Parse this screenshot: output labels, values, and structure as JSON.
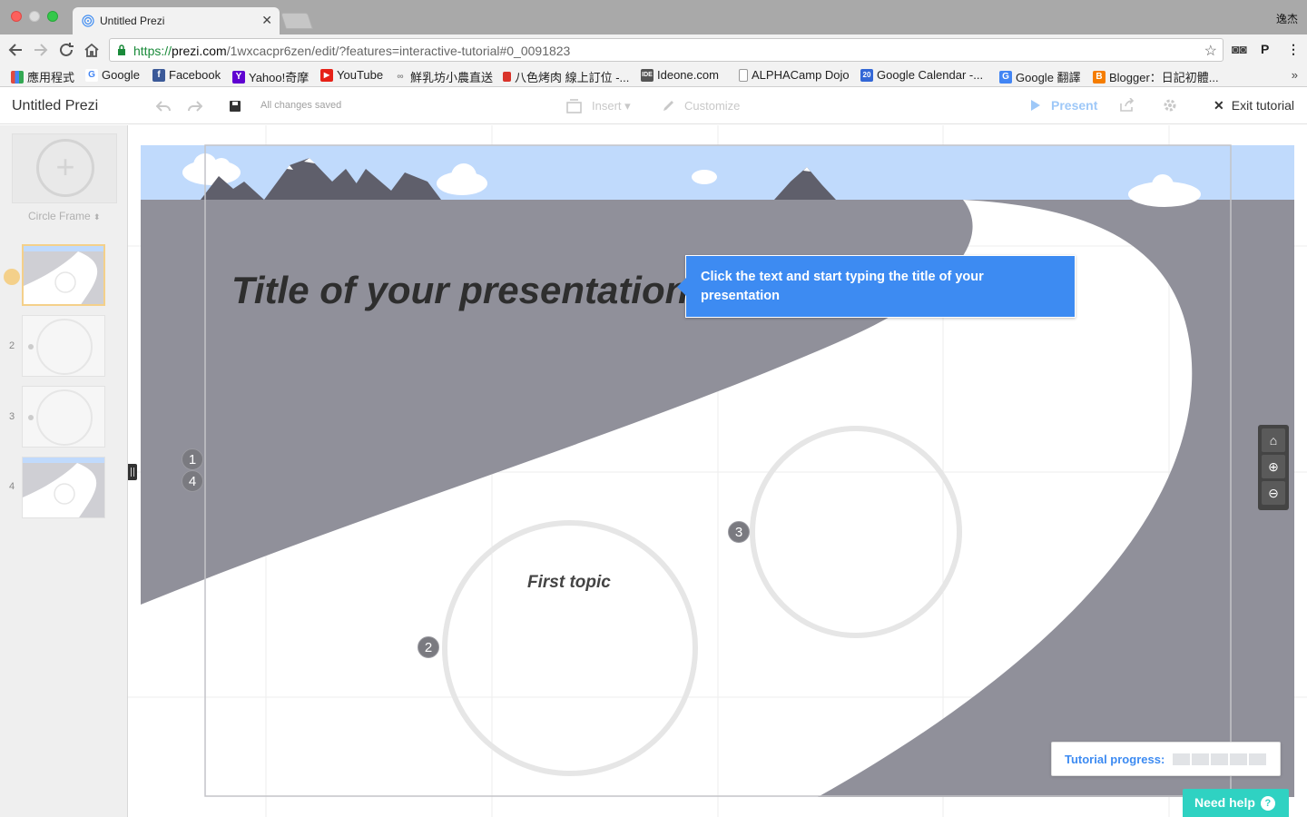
{
  "browser": {
    "tab_title": "Untitled Prezi",
    "profile_name": "逸杰",
    "url_scheme": "https://",
    "url_host": "prezi.com",
    "url_path": "/1wxcacpr6zen/edit/?features=interactive-tutorial#0_0091823"
  },
  "bookmarks": [
    {
      "label": "應用程式",
      "icon": "apps-grid-icon",
      "color": "#e04a3f"
    },
    {
      "label": "Google",
      "icon": "google-icon",
      "color": "#4285f4"
    },
    {
      "label": "Facebook",
      "icon": "facebook-icon",
      "color": "#3b5998"
    },
    {
      "label": "Yahoo!奇摩",
      "icon": "yahoo-icon",
      "color": "#5f01d1"
    },
    {
      "label": "YouTube",
      "icon": "youtube-icon",
      "color": "#e62117"
    },
    {
      "label": "鮮乳坊小農直送",
      "icon": "link-icon",
      "color": "#888888"
    },
    {
      "label": "八色烤肉 線上訂位 -...",
      "icon": "restaurant-icon",
      "color": "#d9342b"
    },
    {
      "label": "Ideone.com",
      "icon": "ideone-icon",
      "color": "#555555"
    },
    {
      "label": "ALPHACamp Dojo",
      "icon": "page-icon",
      "color": "#999999"
    },
    {
      "label": "Google Calendar -...",
      "icon": "calendar-icon",
      "color": "#3367d6"
    },
    {
      "label": "Google 翻譯",
      "icon": "translate-icon",
      "color": "#4285f4"
    },
    {
      "label": "Blogger：日記初體...",
      "icon": "blogger-icon",
      "color": "#f57d00"
    }
  ],
  "toolbar": {
    "title": "Untitled Prezi",
    "saved_status": "All changes saved",
    "insert_label": "Insert",
    "customize_label": "Customize",
    "present_label": "Present",
    "exit_label": "Exit tutorial"
  },
  "sidebar": {
    "frame_type": "Circle Frame",
    "thumb_numbers": [
      "2",
      "3",
      "4"
    ]
  },
  "canvas": {
    "title_text": "Title of your presentation",
    "topic_text": "First topic",
    "path_numbers": [
      "1",
      "4",
      "3",
      "2"
    ],
    "tooltip_text": "Click the text and start typing the title of your presentation"
  },
  "tutorial": {
    "progress_label": "Tutorial progress:",
    "progress_steps_done": 0,
    "progress_steps_total": 5,
    "help_label": "Need help"
  },
  "colors": {
    "accent_blue": "#3d8bf2",
    "help_teal": "#2fd2c2",
    "road_gray": "#90909a",
    "sky_blue": "#c0dafc"
  }
}
